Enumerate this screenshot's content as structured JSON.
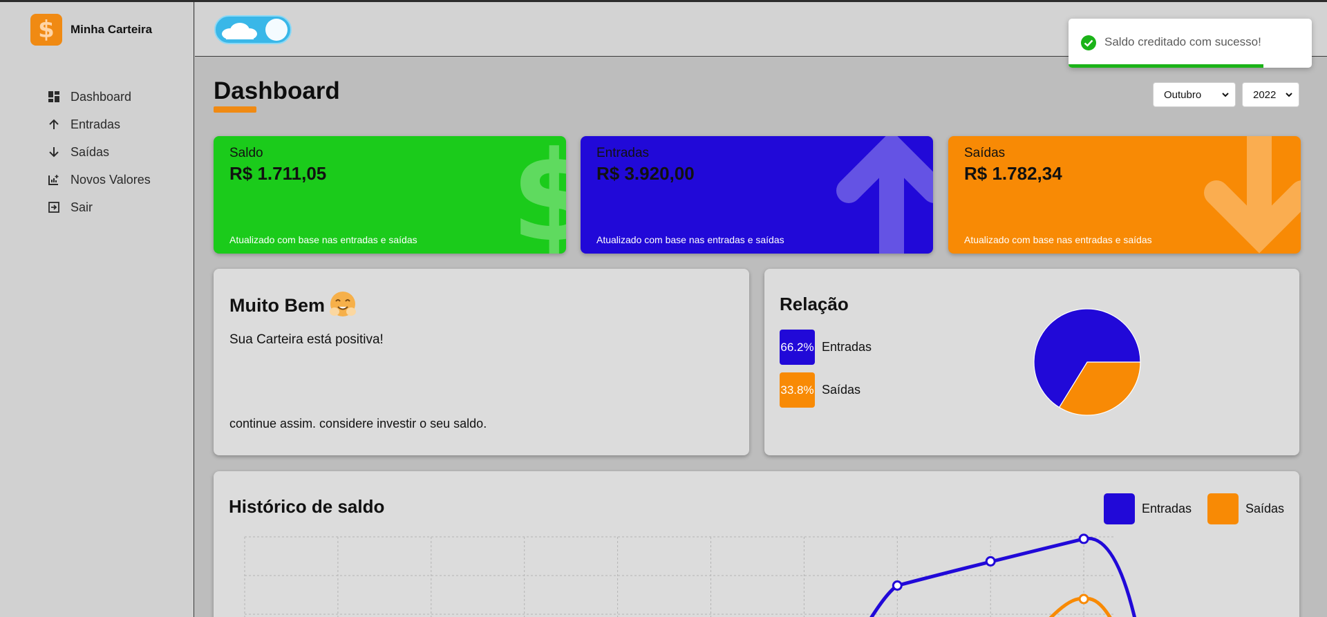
{
  "brand": {
    "name": "Minha Carteira",
    "logo_symbol": "$"
  },
  "sidebar": {
    "items": [
      {
        "label": "Dashboard",
        "icon": "dashboard-icon"
      },
      {
        "label": "Entradas",
        "icon": "arrow-up-icon"
      },
      {
        "label": "Saídas",
        "icon": "arrow-down-icon"
      },
      {
        "label": "Novos Valores",
        "icon": "add-chart-icon"
      },
      {
        "label": "Sair",
        "icon": "logout-icon"
      }
    ]
  },
  "header": {
    "theme_toggle": "dark-mode-toggle"
  },
  "toast": {
    "message": "Saldo creditado com sucesso!",
    "progress": 0.8
  },
  "page": {
    "title": "Dashboard"
  },
  "filters": {
    "month": "Outubro",
    "year": "2022"
  },
  "cards": {
    "saldo": {
      "title": "Saldo",
      "amount": "R$ 1.711,05",
      "footer": "Atualizado com base nas entradas e saídas",
      "color": "#1bcb1b"
    },
    "entradas": {
      "title": "Entradas",
      "amount": "R$ 3.920,00",
      "footer": "Atualizado com base nas entradas e saídas",
      "color": "#2109d8"
    },
    "saidas": {
      "title": "Saídas",
      "amount": "R$ 1.782,34",
      "footer": "Atualizado com base nas entradas e saídas",
      "color": "#f88a05"
    }
  },
  "message": {
    "title": "Muito Bem",
    "description": "Sua Carteira está positiva!",
    "footer": "continue assim. considere investir o seu saldo.",
    "emoji": "hugging-face-emoji"
  },
  "relation": {
    "title": "Relação",
    "items": [
      {
        "label": "Entradas",
        "percent": "66.2%",
        "color": "#2109d8"
      },
      {
        "label": "Saídas",
        "percent": "33.8%",
        "color": "#f88a05"
      }
    ]
  },
  "history": {
    "title": "Histórico de saldo",
    "legend": [
      {
        "label": "Entradas",
        "color": "#2109d8"
      },
      {
        "label": "Saídas",
        "color": "#f88a05"
      }
    ]
  },
  "chart_data": [
    {
      "type": "pie",
      "categories": [
        "Entradas",
        "Saídas"
      ],
      "values": [
        66.2,
        33.8
      ],
      "colors": [
        "#2109d8",
        "#f88a05"
      ]
    },
    {
      "type": "line",
      "title": "Histórico de saldo",
      "grid": true,
      "legend_position": "top-right",
      "series": [
        {
          "name": "Entradas",
          "color": "#2109d8",
          "points": [
            [
              8,
              0.35
            ],
            [
              9,
              0.62
            ],
            [
              10,
              0.87
            ]
          ]
        },
        {
          "name": "Saídas",
          "color": "#f88a05",
          "points": [
            [
              10,
              0.2
            ]
          ]
        }
      ]
    }
  ]
}
